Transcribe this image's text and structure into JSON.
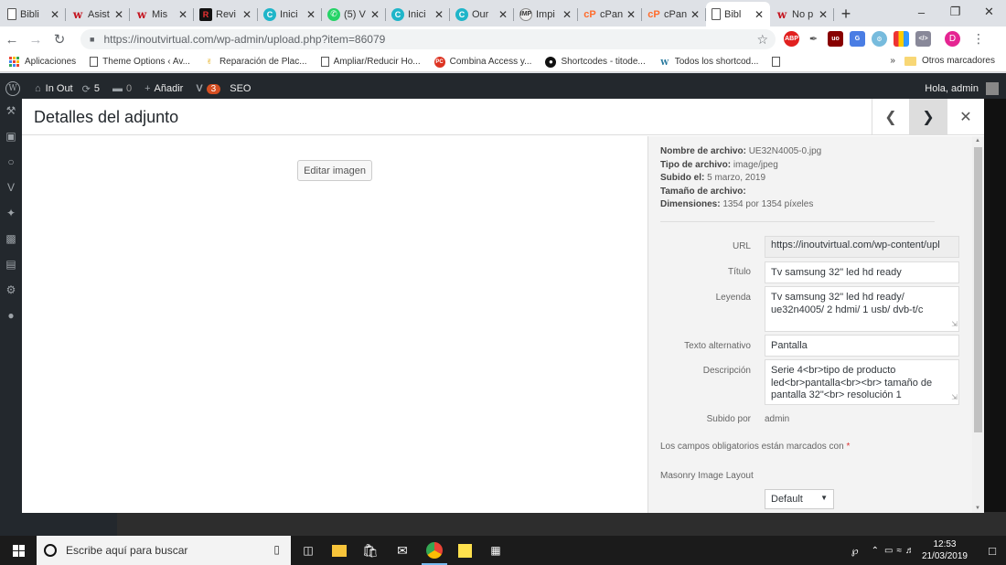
{
  "browser": {
    "tabs": [
      {
        "label": "Bibli",
        "icon": "document-icon"
      },
      {
        "label": "Asist",
        "icon": "w-logo-icon"
      },
      {
        "label": "Mis",
        "icon": "w-logo-icon"
      },
      {
        "label": "Revi",
        "icon": "review-icon"
      },
      {
        "label": "Inici",
        "icon": "c-logo-icon"
      },
      {
        "label": "(5) V",
        "icon": "whatsapp-icon"
      },
      {
        "label": "Inici",
        "icon": "c-logo-icon"
      },
      {
        "label": "Our",
        "icon": "c-logo-icon"
      },
      {
        "label": "Impi",
        "icon": "imp-icon"
      },
      {
        "label": "cPan",
        "icon": "cpanel-icon"
      },
      {
        "label": "cPan",
        "icon": "cpanel-icon"
      },
      {
        "label": "Bibl",
        "icon": "document-icon",
        "active": true
      },
      {
        "label": "No p",
        "icon": "w-logo-icon"
      }
    ],
    "url": "https://inoutvirtual.com/wp-admin/upload.php?item=86079",
    "bookmarks": [
      "Aplicaciones",
      "Theme Options ‹ Av...",
      "Reparación de Plac...",
      "Ampliar/Reducir Ho...",
      "Combina Access y...",
      "Shortcodes - titode...",
      "Todos los shortcod..."
    ],
    "bookmarks_more": "»",
    "other_bookmarks": "Otros marcadores",
    "profile_initial": "D"
  },
  "wpadmin": {
    "site_name": "In Out",
    "updates": "5",
    "comments": "0",
    "add_new": "Añadir",
    "plugin_badge": "3",
    "seo": "SEO",
    "greeting": "Hola, admin"
  },
  "modal": {
    "title": "Detalles del adjunto",
    "edit_image": "Editar imagen",
    "meta": {
      "filename_label": "Nombre de archivo:",
      "filename": "UE32N4005-0.jpg",
      "filetype_label": "Tipo de archivo:",
      "filetype": "image/jpeg",
      "uploaded_label": "Subido el:",
      "uploaded": "5 marzo, 2019",
      "size_label": "Tamaño de archivo:",
      "size": "",
      "dimensions_label": "Dimensiones:",
      "dimensions": "1354 por 1354 píxeles"
    },
    "fields": {
      "url_label": "URL",
      "url": "https://inoutvirtual.com/wp-content/upl",
      "title_label": "Título",
      "title": "Tv samsung 32\" led hd ready",
      "caption_label": "Leyenda",
      "caption": "Tv samsung 32\" led hd ready/ ue32n4005/ 2 hdmi/ 1 usb/ dvb-t/c",
      "alt_label": "Texto alternativo",
      "alt": "Pantalla",
      "description_label": "Descripción",
      "description": "Serie 4<br>tipo de producto led<br>pantalla<br><br>    tamaño de pantalla 32\"<br>    resolución 1",
      "uploaded_by_label": "Subido por",
      "uploaded_by": "admin"
    },
    "required_note": "Los campos obligatorios están marcados con",
    "required_star": "*",
    "masonry_label": "Masonry Image Layout",
    "masonry_value": "Default"
  },
  "taskbar": {
    "search_placeholder": "Escribe aquí para buscar",
    "time": "12:53",
    "date": "21/03/2019"
  }
}
